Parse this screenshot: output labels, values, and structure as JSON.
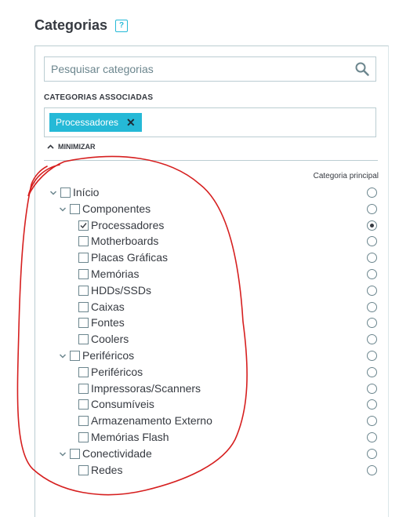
{
  "header": {
    "title": "Categorias",
    "help_icon": "?"
  },
  "search": {
    "placeholder": "Pesquisar categorias",
    "icon": "search-icon"
  },
  "associated": {
    "label": "CATEGORIAS ASSOCIADAS",
    "tags": [
      {
        "label": "Processadores",
        "remove_icon": "close-icon"
      }
    ]
  },
  "minimize_label": "MINIMIZAR",
  "main_category_header": "Categoria principal",
  "tree": [
    {
      "label": "Início",
      "level": 0,
      "expanded": true,
      "checked": false,
      "main": false
    },
    {
      "label": "Componentes",
      "level": 1,
      "expanded": true,
      "checked": false,
      "main": false
    },
    {
      "label": "Processadores",
      "level": 2,
      "checked": true,
      "main": true
    },
    {
      "label": "Motherboards",
      "level": 2,
      "checked": false,
      "main": false
    },
    {
      "label": "Placas Gráficas",
      "level": 2,
      "checked": false,
      "main": false
    },
    {
      "label": "Memórias",
      "level": 2,
      "checked": false,
      "main": false
    },
    {
      "label": "HDDs/SSDs",
      "level": 2,
      "checked": false,
      "main": false
    },
    {
      "label": "Caixas",
      "level": 2,
      "checked": false,
      "main": false
    },
    {
      "label": "Fontes",
      "level": 2,
      "checked": false,
      "main": false
    },
    {
      "label": "Coolers",
      "level": 2,
      "checked": false,
      "main": false
    },
    {
      "label": "Periféricos",
      "level": 1,
      "expanded": true,
      "checked": false,
      "main": false
    },
    {
      "label": "Periféricos",
      "level": 2,
      "checked": false,
      "main": false
    },
    {
      "label": "Impressoras/Scanners",
      "level": 2,
      "checked": false,
      "main": false
    },
    {
      "label": "Consumíveis",
      "level": 2,
      "checked": false,
      "main": false
    },
    {
      "label": "Armazenamento Externo",
      "level": 2,
      "checked": false,
      "main": false
    },
    {
      "label": "Memórias Flash",
      "level": 2,
      "checked": false,
      "main": false
    },
    {
      "label": "Conectividade",
      "level": 1,
      "expanded": true,
      "checked": false,
      "main": false
    },
    {
      "label": "Redes",
      "level": 2,
      "checked": false,
      "main": false
    }
  ],
  "colors": {
    "accent": "#25b9d7",
    "text": "#363a41",
    "border": "#bbcdd2",
    "annotation": "#d61f1f"
  }
}
